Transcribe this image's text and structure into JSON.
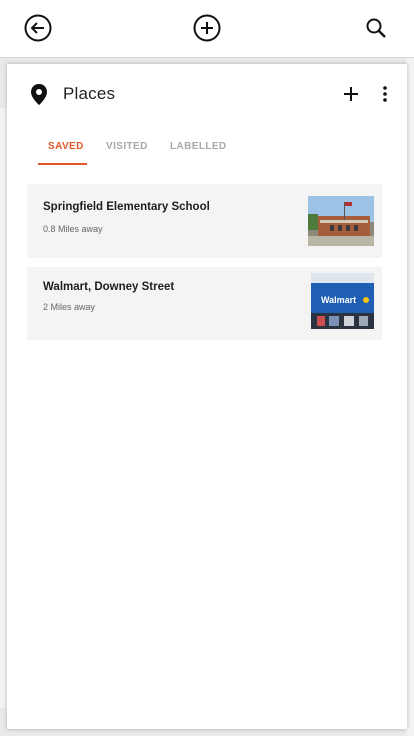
{
  "topbar": {
    "back_icon": "arrow-left-circle-icon",
    "add_icon": "plus-circle-icon",
    "search_icon": "search-icon"
  },
  "panel": {
    "title": "Places",
    "title_icon": "location-pin-icon",
    "add_icon": "plus-icon",
    "more_icon": "more-vertical-icon"
  },
  "tabs": [
    {
      "label": "SAVED",
      "active": true
    },
    {
      "label": "VISITED",
      "active": false
    },
    {
      "label": "LABELLED",
      "active": false
    }
  ],
  "places": [
    {
      "name": "Springfield Elementary School",
      "distance": "0.8 Miles away"
    },
    {
      "name": "Walmart, Downey Street",
      "distance": "2 Miles away",
      "sign": "Walmart"
    }
  ],
  "colors": {
    "accent": "#e2592b",
    "tab_inactive": "#a9a9a9",
    "card_bg": "#f4f4f4",
    "walmart_blue": "#1f5fb4",
    "walmart_spark": "#f6c218"
  }
}
